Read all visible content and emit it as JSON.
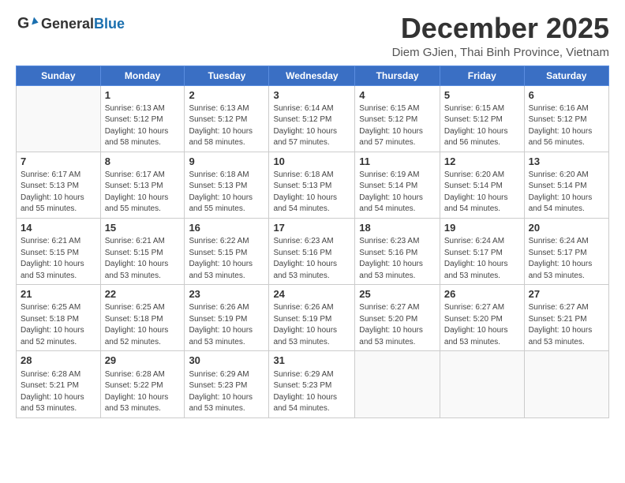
{
  "logo": {
    "general": "General",
    "blue": "Blue"
  },
  "header": {
    "month": "December 2025",
    "location": "Diem GJien, Thai Binh Province, Vietnam"
  },
  "weekdays": [
    "Sunday",
    "Monday",
    "Tuesday",
    "Wednesday",
    "Thursday",
    "Friday",
    "Saturday"
  ],
  "weeks": [
    [
      {
        "day": "",
        "sunrise": "",
        "sunset": "",
        "daylight": ""
      },
      {
        "day": "1",
        "sunrise": "6:13 AM",
        "sunset": "5:12 PM",
        "daylight": "10 hours and 58 minutes."
      },
      {
        "day": "2",
        "sunrise": "6:13 AM",
        "sunset": "5:12 PM",
        "daylight": "10 hours and 58 minutes."
      },
      {
        "day": "3",
        "sunrise": "6:14 AM",
        "sunset": "5:12 PM",
        "daylight": "10 hours and 57 minutes."
      },
      {
        "day": "4",
        "sunrise": "6:15 AM",
        "sunset": "5:12 PM",
        "daylight": "10 hours and 57 minutes."
      },
      {
        "day": "5",
        "sunrise": "6:15 AM",
        "sunset": "5:12 PM",
        "daylight": "10 hours and 56 minutes."
      },
      {
        "day": "6",
        "sunrise": "6:16 AM",
        "sunset": "5:12 PM",
        "daylight": "10 hours and 56 minutes."
      }
    ],
    [
      {
        "day": "7",
        "sunrise": "6:17 AM",
        "sunset": "5:13 PM",
        "daylight": "10 hours and 55 minutes."
      },
      {
        "day": "8",
        "sunrise": "6:17 AM",
        "sunset": "5:13 PM",
        "daylight": "10 hours and 55 minutes."
      },
      {
        "day": "9",
        "sunrise": "6:18 AM",
        "sunset": "5:13 PM",
        "daylight": "10 hours and 55 minutes."
      },
      {
        "day": "10",
        "sunrise": "6:18 AM",
        "sunset": "5:13 PM",
        "daylight": "10 hours and 54 minutes."
      },
      {
        "day": "11",
        "sunrise": "6:19 AM",
        "sunset": "5:14 PM",
        "daylight": "10 hours and 54 minutes."
      },
      {
        "day": "12",
        "sunrise": "6:20 AM",
        "sunset": "5:14 PM",
        "daylight": "10 hours and 54 minutes."
      },
      {
        "day": "13",
        "sunrise": "6:20 AM",
        "sunset": "5:14 PM",
        "daylight": "10 hours and 54 minutes."
      }
    ],
    [
      {
        "day": "14",
        "sunrise": "6:21 AM",
        "sunset": "5:15 PM",
        "daylight": "10 hours and 53 minutes."
      },
      {
        "day": "15",
        "sunrise": "6:21 AM",
        "sunset": "5:15 PM",
        "daylight": "10 hours and 53 minutes."
      },
      {
        "day": "16",
        "sunrise": "6:22 AM",
        "sunset": "5:15 PM",
        "daylight": "10 hours and 53 minutes."
      },
      {
        "day": "17",
        "sunrise": "6:23 AM",
        "sunset": "5:16 PM",
        "daylight": "10 hours and 53 minutes."
      },
      {
        "day": "18",
        "sunrise": "6:23 AM",
        "sunset": "5:16 PM",
        "daylight": "10 hours and 53 minutes."
      },
      {
        "day": "19",
        "sunrise": "6:24 AM",
        "sunset": "5:17 PM",
        "daylight": "10 hours and 53 minutes."
      },
      {
        "day": "20",
        "sunrise": "6:24 AM",
        "sunset": "5:17 PM",
        "daylight": "10 hours and 53 minutes."
      }
    ],
    [
      {
        "day": "21",
        "sunrise": "6:25 AM",
        "sunset": "5:18 PM",
        "daylight": "10 hours and 52 minutes."
      },
      {
        "day": "22",
        "sunrise": "6:25 AM",
        "sunset": "5:18 PM",
        "daylight": "10 hours and 52 minutes."
      },
      {
        "day": "23",
        "sunrise": "6:26 AM",
        "sunset": "5:19 PM",
        "daylight": "10 hours and 53 minutes."
      },
      {
        "day": "24",
        "sunrise": "6:26 AM",
        "sunset": "5:19 PM",
        "daylight": "10 hours and 53 minutes."
      },
      {
        "day": "25",
        "sunrise": "6:27 AM",
        "sunset": "5:20 PM",
        "daylight": "10 hours and 53 minutes."
      },
      {
        "day": "26",
        "sunrise": "6:27 AM",
        "sunset": "5:20 PM",
        "daylight": "10 hours and 53 minutes."
      },
      {
        "day": "27",
        "sunrise": "6:27 AM",
        "sunset": "5:21 PM",
        "daylight": "10 hours and 53 minutes."
      }
    ],
    [
      {
        "day": "28",
        "sunrise": "6:28 AM",
        "sunset": "5:21 PM",
        "daylight": "10 hours and 53 minutes."
      },
      {
        "day": "29",
        "sunrise": "6:28 AM",
        "sunset": "5:22 PM",
        "daylight": "10 hours and 53 minutes."
      },
      {
        "day": "30",
        "sunrise": "6:29 AM",
        "sunset": "5:23 PM",
        "daylight": "10 hours and 53 minutes."
      },
      {
        "day": "31",
        "sunrise": "6:29 AM",
        "sunset": "5:23 PM",
        "daylight": "10 hours and 54 minutes."
      },
      {
        "day": "",
        "sunrise": "",
        "sunset": "",
        "daylight": ""
      },
      {
        "day": "",
        "sunrise": "",
        "sunset": "",
        "daylight": ""
      },
      {
        "day": "",
        "sunrise": "",
        "sunset": "",
        "daylight": ""
      }
    ]
  ]
}
